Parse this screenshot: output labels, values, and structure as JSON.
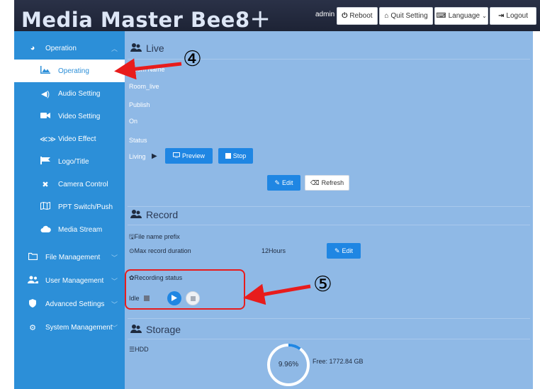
{
  "header": {
    "brand": "Media Master Bee8＋",
    "user": "admin",
    "buttons": [
      {
        "icon": "⏻",
        "label": "Reboot",
        "name": "reboot-button"
      },
      {
        "icon": "⌂",
        "label": "Quit Setting",
        "name": "quit-setting-button"
      },
      {
        "icon": "⌨",
        "label": "Language",
        "name": "language-button"
      },
      {
        "icon": "⇥",
        "label": "Logout",
        "name": "logout-button"
      }
    ]
  },
  "sidebar": {
    "items": [
      {
        "label": "Operation",
        "icon": "dashboard-icon"
      },
      {
        "label": "Operating",
        "icon": "chart-icon"
      },
      {
        "label": "Audio Setting",
        "icon": "speaker-icon"
      },
      {
        "label": "Video Setting",
        "icon": "camera-icon"
      },
      {
        "label": "Video Effect",
        "icon": "effect-icon"
      },
      {
        "label": "Logo/Title",
        "icon": "flag-icon"
      },
      {
        "label": "Camera Control",
        "icon": "camera-control-icon"
      },
      {
        "label": "PPT Switch/Push",
        "icon": "map-icon"
      },
      {
        "label": "Media Stream",
        "icon": "cloud-icon"
      },
      {
        "label": "File Management",
        "icon": "folder-icon"
      },
      {
        "label": "User Management",
        "icon": "users-icon"
      },
      {
        "label": "Advanced Settings",
        "icon": "shield-icon"
      },
      {
        "label": "System Management",
        "icon": "gears-icon"
      }
    ]
  },
  "live": {
    "title": "Live",
    "room_name_label": "Room Name",
    "room_name_value": "Room_live",
    "publish_label": "Publish",
    "publish_value": "On",
    "status_label": "Status",
    "status_value": "Living",
    "preview_label": "Preview",
    "stop_label": "Stop",
    "edit_label": "Edit",
    "refresh_label": "Refresh"
  },
  "record": {
    "title": "Record",
    "prefix_label": "File name prefix",
    "duration_label": "Max record duration",
    "duration_value": "12Hours",
    "edit_label": "Edit",
    "status_label": "Recording status",
    "status_value": "Idle"
  },
  "storage": {
    "title": "Storage",
    "device_label": "HDD",
    "used_percent_text": "9.96%",
    "used_fraction": 0.0996,
    "free_text": "Free: 1772.84 GB"
  },
  "annotations": {
    "four": "④",
    "five": "⑤"
  },
  "colors": {
    "sidebar": "#2c8fd8",
    "main": "#8fb9e6",
    "accent_button": "#1f86e3",
    "annotation": "#e81c1c"
  }
}
